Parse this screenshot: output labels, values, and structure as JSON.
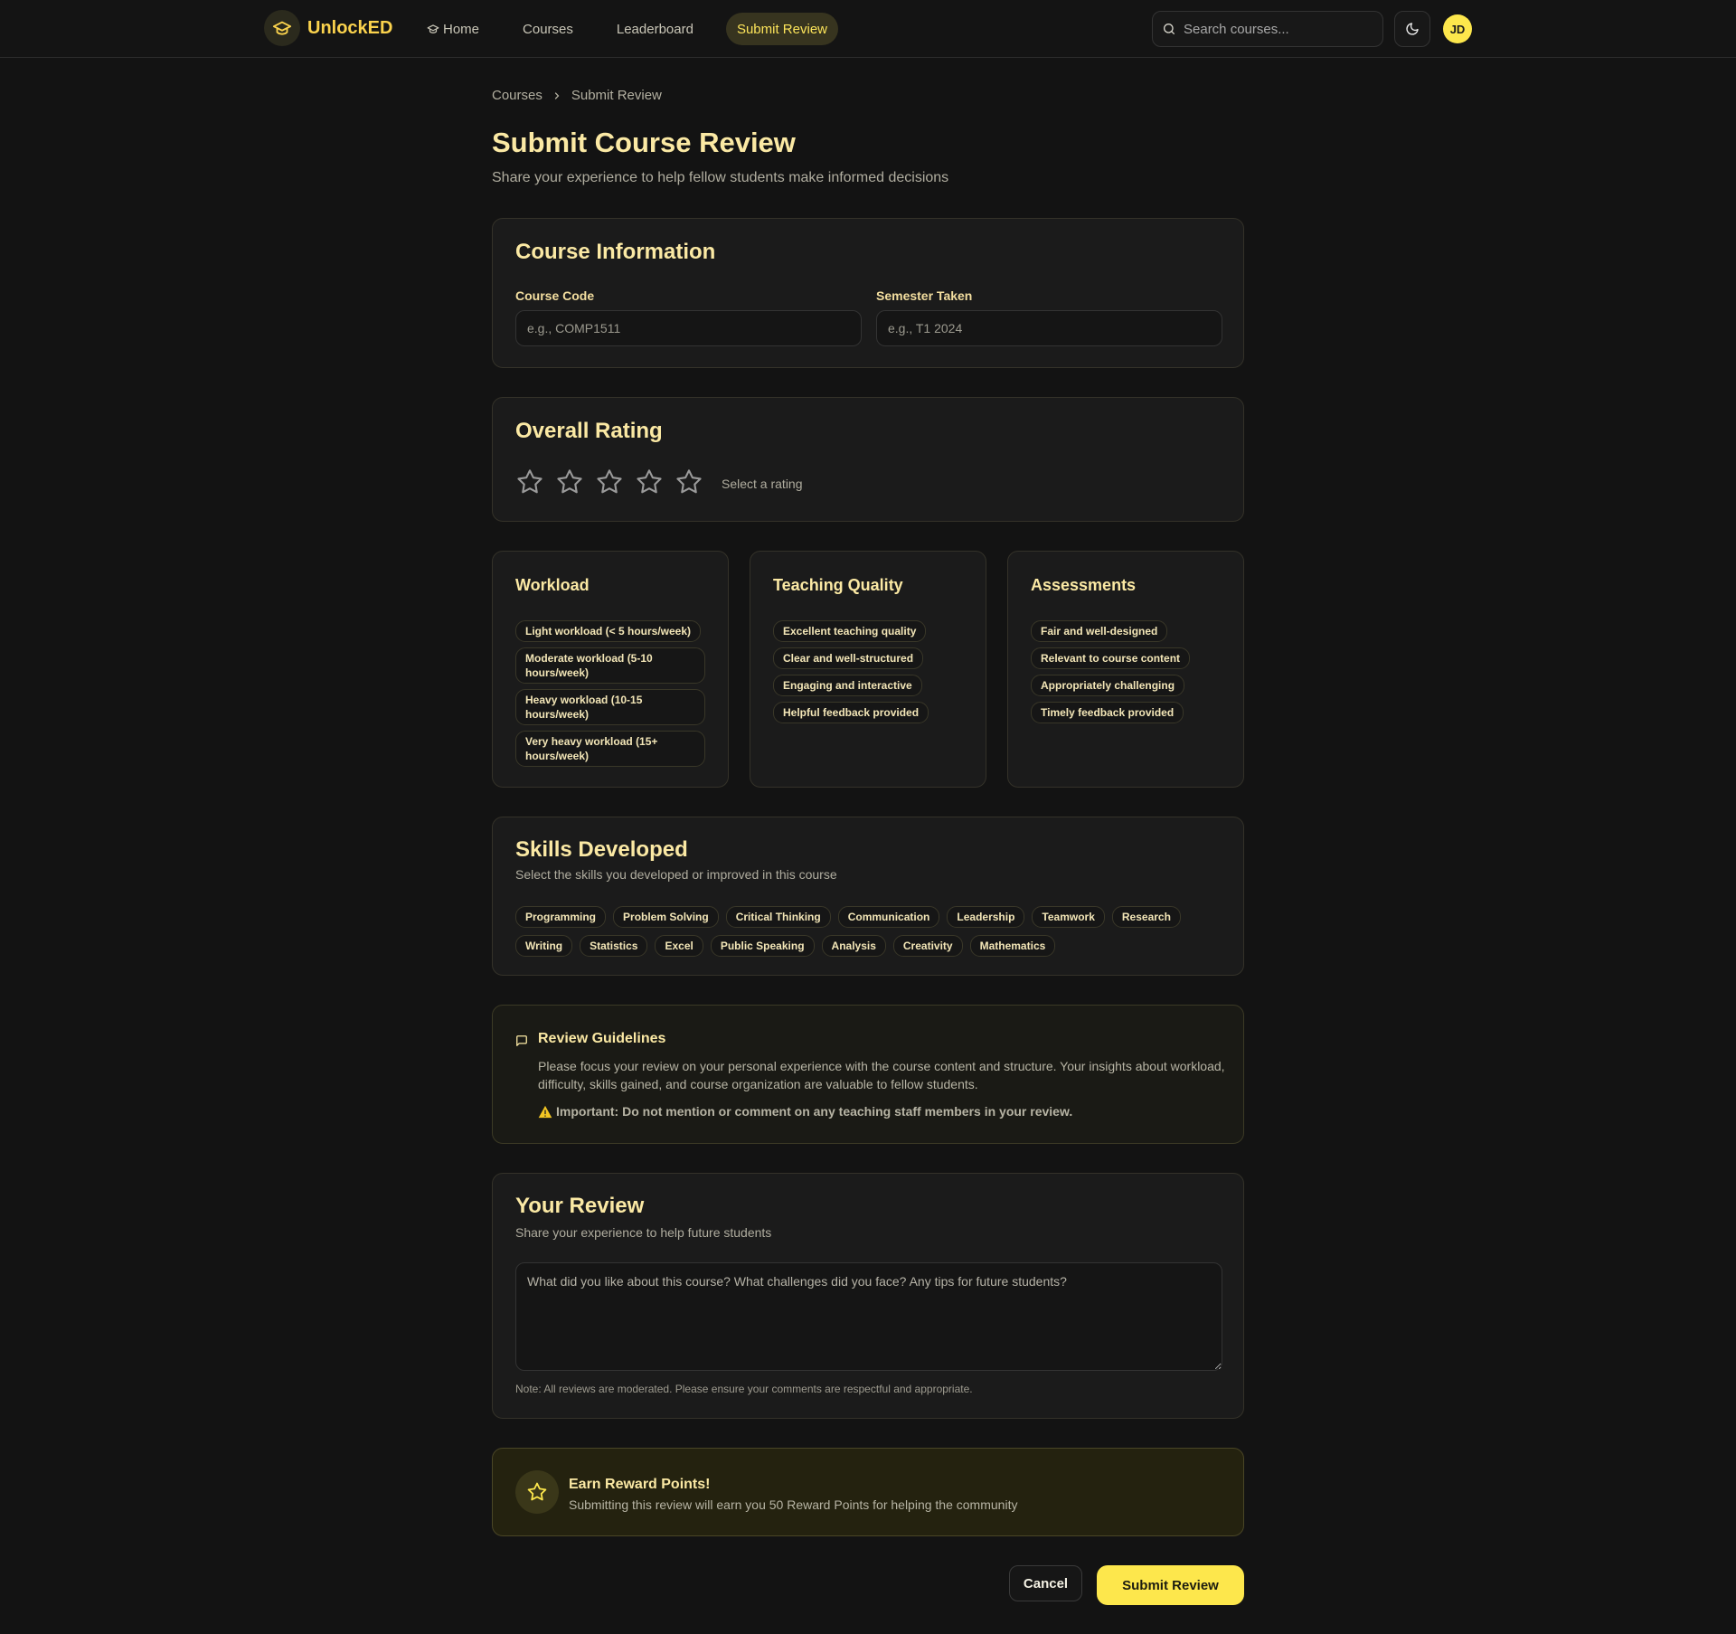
{
  "colors": {
    "accent": "#fde74c",
    "brand": "#fbd34d",
    "background": "#131313",
    "card": "#1b1b1b",
    "heading": "#fbe9a4"
  },
  "nav": {
    "brand_name": "UnlockED",
    "brand_icon": "graduation-cap-icon",
    "links": [
      {
        "label": "Home",
        "icon": "graduation-cap-icon"
      },
      {
        "label": "Courses"
      },
      {
        "label": "Leaderboard"
      },
      {
        "label": "Submit Review",
        "active": true
      }
    ],
    "search_placeholder": "Search courses...",
    "theme_icon": "moon-icon",
    "avatar_initials": "JD"
  },
  "breadcrumb": {
    "items": [
      "Courses",
      "Submit Review"
    ]
  },
  "page": {
    "title": "Submit Course Review",
    "subtitle": "Share your experience to help fellow students make informed decisions"
  },
  "course_info": {
    "title": "Course Information",
    "course_code_label": "Course Code",
    "course_code_placeholder": "e.g., COMP1511",
    "course_code_value": "",
    "semester_label": "Semester Taken",
    "semester_placeholder": "e.g., T1 2024",
    "semester_value": ""
  },
  "rating": {
    "title": "Overall Rating",
    "max_stars": 5,
    "selected": 0,
    "hint": "Select a rating"
  },
  "workload": {
    "title": "Workload",
    "options": [
      "Light workload (< 5 hours/week)",
      "Moderate workload (5-10 hours/week)",
      "Heavy workload (10-15 hours/week)",
      "Very heavy workload (15+ hours/week)"
    ]
  },
  "teaching": {
    "title": "Teaching Quality",
    "options": [
      "Excellent teaching quality",
      "Clear and well-structured",
      "Engaging and interactive",
      "Helpful feedback provided"
    ]
  },
  "assessments": {
    "title": "Assessments",
    "options": [
      "Fair and well-designed",
      "Relevant to course content",
      "Appropriately challenging",
      "Timely feedback provided"
    ]
  },
  "skills": {
    "title": "Skills Developed",
    "subtitle": "Select the skills you developed or improved in this course",
    "items": [
      "Programming",
      "Problem Solving",
      "Critical Thinking",
      "Communication",
      "Leadership",
      "Teamwork",
      "Research",
      "Writing",
      "Statistics",
      "Excel",
      "Public Speaking",
      "Analysis",
      "Creativity",
      "Mathematics"
    ]
  },
  "guidelines": {
    "icon": "message-square-icon",
    "title": "Review Guidelines",
    "text": "Please focus your review on your personal experience with the course content and structure. Your insights about workload, difficulty, skills gained, and course organization are valuable to fellow students.",
    "warning_icon": "warning-icon",
    "warning": "Important: Do not mention or comment on any teaching staff members in your review."
  },
  "review": {
    "title": "Your Review",
    "subtitle": "Share your experience to help future students",
    "placeholder": "What did you like about this course? What challenges did you face? Any tips for future students?",
    "note": "Note: All reviews are moderated. Please ensure your comments are respectful and appropriate."
  },
  "reward": {
    "icon": "star-icon",
    "title": "Earn Reward Points!",
    "text": "Submitting this review will earn you 50 Reward Points for helping the community"
  },
  "actions": {
    "cancel": "Cancel",
    "submit": "Submit Review"
  }
}
